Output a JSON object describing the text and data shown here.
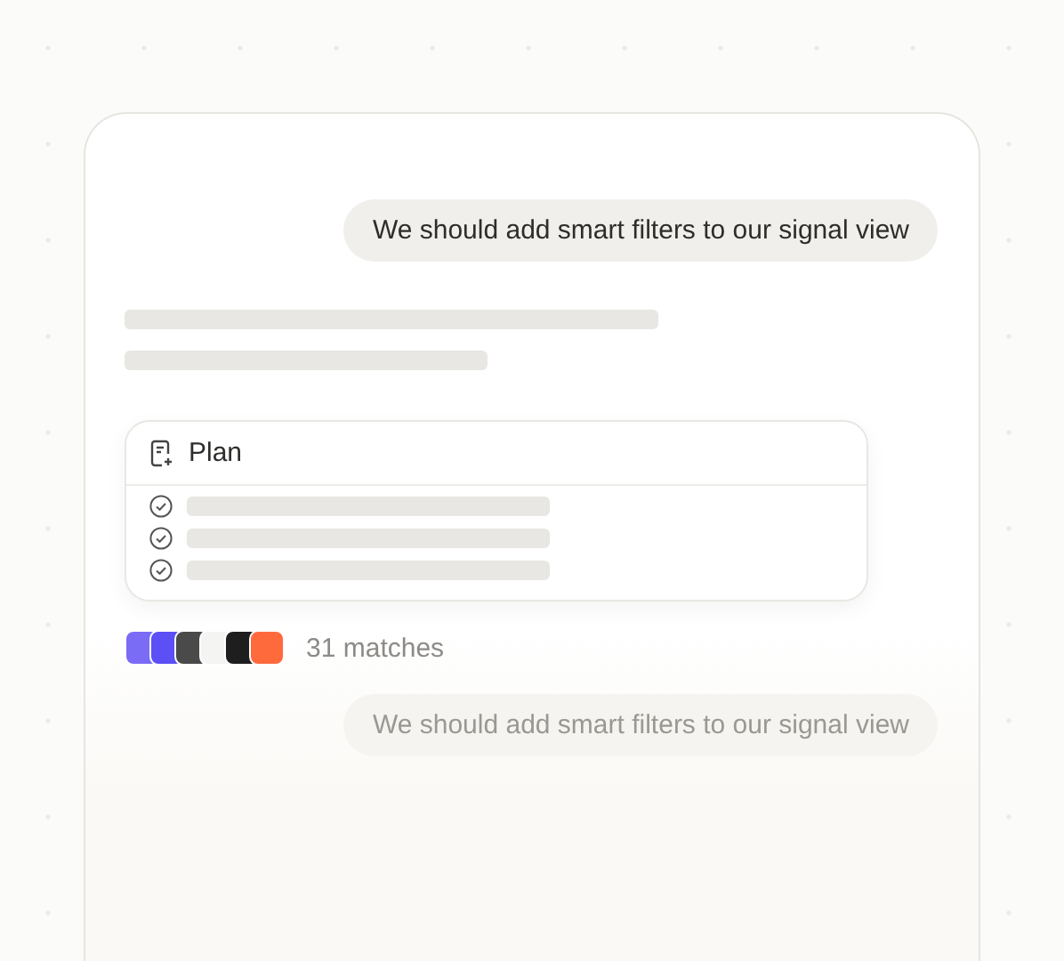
{
  "message": "We should add smart filters to our signal view",
  "plan": {
    "title": "Plan",
    "steps": [
      {
        "checked": true
      },
      {
        "checked": true
      },
      {
        "checked": true
      }
    ]
  },
  "integrations": [
    {
      "color": "#7b6cf6"
    },
    {
      "color": "#5b4ff5"
    },
    {
      "color": "#4a4a4a"
    },
    {
      "color": "#f4f4f2"
    },
    {
      "color": "#1e1e1e"
    },
    {
      "color": "#ff6a3d"
    }
  ],
  "matches": "31 matches",
  "next_message": "We should add smart filters to our signal view"
}
